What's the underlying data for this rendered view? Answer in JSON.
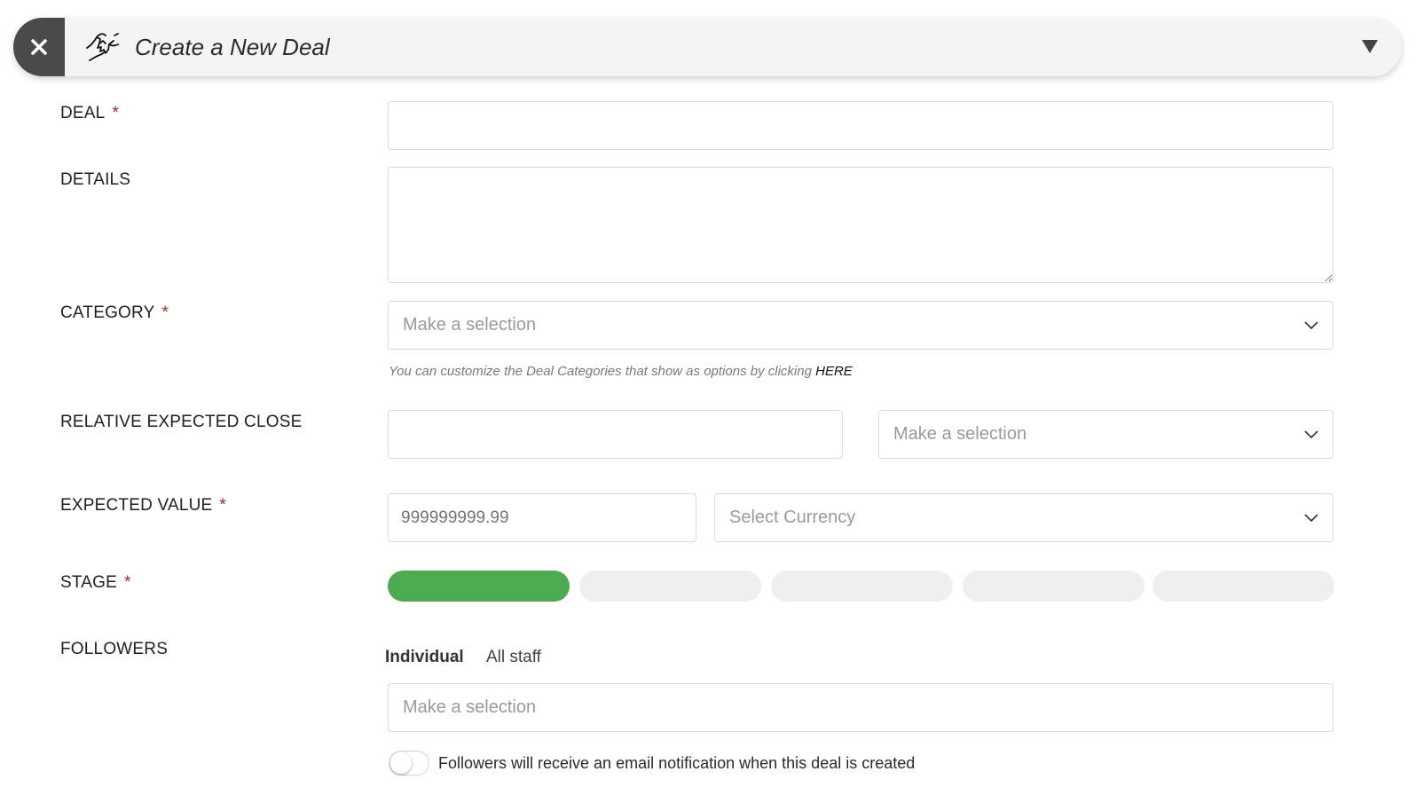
{
  "header": {
    "title": "Create a New Deal",
    "close_icon": "close-icon",
    "deal_icon": "handshake-icon",
    "collapse_icon": "triangle-down-icon",
    "close_bg": "#4a4a4a"
  },
  "form": {
    "deal": {
      "label": "DEAL",
      "required_mark": "*",
      "value": ""
    },
    "details": {
      "label": "DETAILS",
      "value": ""
    },
    "category": {
      "label": "CATEGORY",
      "required_mark": "*",
      "placeholder": "Make a selection",
      "help_text": "You can customize the Deal Categories that show as options by clicking",
      "help_link": "HERE"
    },
    "relative_expected_close": {
      "label": "RELATIVE EXPECTED CLOSE",
      "value": "",
      "unit_placeholder": "Make a selection"
    },
    "expected_value": {
      "label": "EXPECTED VALUE",
      "required_mark": "*",
      "placeholder": "999999999.99",
      "currency_placeholder": "Select Currency"
    },
    "stage": {
      "label": "STAGE",
      "required_mark": "*",
      "active_color": "#4caa50",
      "active_index": 0,
      "count": 5
    },
    "followers": {
      "label": "FOLLOWERS",
      "tabs": [
        "Individual",
        "All staff"
      ],
      "active_tab": "Individual",
      "placeholder": "Make a selection",
      "notify_label": "Followers will receive an email notification when this deal is created",
      "notify_enabled": false
    }
  },
  "colors": {
    "required": "#a0282c",
    "header_bg": "#f4f4f4"
  }
}
